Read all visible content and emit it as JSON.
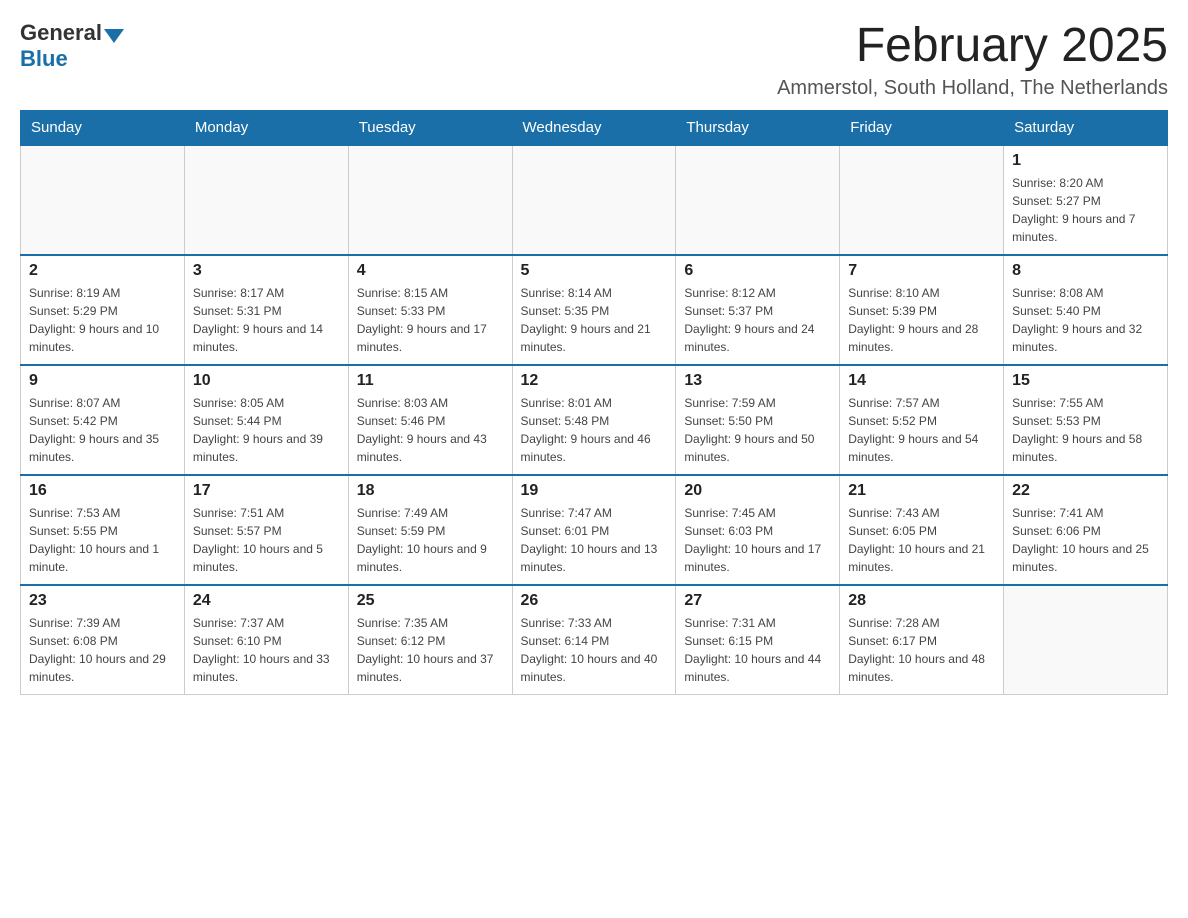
{
  "logo": {
    "general": "General",
    "blue": "Blue"
  },
  "title": {
    "month_year": "February 2025",
    "location": "Ammerstol, South Holland, The Netherlands"
  },
  "headers": [
    "Sunday",
    "Monday",
    "Tuesday",
    "Wednesday",
    "Thursday",
    "Friday",
    "Saturday"
  ],
  "weeks": [
    [
      {
        "day": "",
        "info": ""
      },
      {
        "day": "",
        "info": ""
      },
      {
        "day": "",
        "info": ""
      },
      {
        "day": "",
        "info": ""
      },
      {
        "day": "",
        "info": ""
      },
      {
        "day": "",
        "info": ""
      },
      {
        "day": "1",
        "info": "Sunrise: 8:20 AM\nSunset: 5:27 PM\nDaylight: 9 hours and 7 minutes."
      }
    ],
    [
      {
        "day": "2",
        "info": "Sunrise: 8:19 AM\nSunset: 5:29 PM\nDaylight: 9 hours and 10 minutes."
      },
      {
        "day": "3",
        "info": "Sunrise: 8:17 AM\nSunset: 5:31 PM\nDaylight: 9 hours and 14 minutes."
      },
      {
        "day": "4",
        "info": "Sunrise: 8:15 AM\nSunset: 5:33 PM\nDaylight: 9 hours and 17 minutes."
      },
      {
        "day": "5",
        "info": "Sunrise: 8:14 AM\nSunset: 5:35 PM\nDaylight: 9 hours and 21 minutes."
      },
      {
        "day": "6",
        "info": "Sunrise: 8:12 AM\nSunset: 5:37 PM\nDaylight: 9 hours and 24 minutes."
      },
      {
        "day": "7",
        "info": "Sunrise: 8:10 AM\nSunset: 5:39 PM\nDaylight: 9 hours and 28 minutes."
      },
      {
        "day": "8",
        "info": "Sunrise: 8:08 AM\nSunset: 5:40 PM\nDaylight: 9 hours and 32 minutes."
      }
    ],
    [
      {
        "day": "9",
        "info": "Sunrise: 8:07 AM\nSunset: 5:42 PM\nDaylight: 9 hours and 35 minutes."
      },
      {
        "day": "10",
        "info": "Sunrise: 8:05 AM\nSunset: 5:44 PM\nDaylight: 9 hours and 39 minutes."
      },
      {
        "day": "11",
        "info": "Sunrise: 8:03 AM\nSunset: 5:46 PM\nDaylight: 9 hours and 43 minutes."
      },
      {
        "day": "12",
        "info": "Sunrise: 8:01 AM\nSunset: 5:48 PM\nDaylight: 9 hours and 46 minutes."
      },
      {
        "day": "13",
        "info": "Sunrise: 7:59 AM\nSunset: 5:50 PM\nDaylight: 9 hours and 50 minutes."
      },
      {
        "day": "14",
        "info": "Sunrise: 7:57 AM\nSunset: 5:52 PM\nDaylight: 9 hours and 54 minutes."
      },
      {
        "day": "15",
        "info": "Sunrise: 7:55 AM\nSunset: 5:53 PM\nDaylight: 9 hours and 58 minutes."
      }
    ],
    [
      {
        "day": "16",
        "info": "Sunrise: 7:53 AM\nSunset: 5:55 PM\nDaylight: 10 hours and 1 minute."
      },
      {
        "day": "17",
        "info": "Sunrise: 7:51 AM\nSunset: 5:57 PM\nDaylight: 10 hours and 5 minutes."
      },
      {
        "day": "18",
        "info": "Sunrise: 7:49 AM\nSunset: 5:59 PM\nDaylight: 10 hours and 9 minutes."
      },
      {
        "day": "19",
        "info": "Sunrise: 7:47 AM\nSunset: 6:01 PM\nDaylight: 10 hours and 13 minutes."
      },
      {
        "day": "20",
        "info": "Sunrise: 7:45 AM\nSunset: 6:03 PM\nDaylight: 10 hours and 17 minutes."
      },
      {
        "day": "21",
        "info": "Sunrise: 7:43 AM\nSunset: 6:05 PM\nDaylight: 10 hours and 21 minutes."
      },
      {
        "day": "22",
        "info": "Sunrise: 7:41 AM\nSunset: 6:06 PM\nDaylight: 10 hours and 25 minutes."
      }
    ],
    [
      {
        "day": "23",
        "info": "Sunrise: 7:39 AM\nSunset: 6:08 PM\nDaylight: 10 hours and 29 minutes."
      },
      {
        "day": "24",
        "info": "Sunrise: 7:37 AM\nSunset: 6:10 PM\nDaylight: 10 hours and 33 minutes."
      },
      {
        "day": "25",
        "info": "Sunrise: 7:35 AM\nSunset: 6:12 PM\nDaylight: 10 hours and 37 minutes."
      },
      {
        "day": "26",
        "info": "Sunrise: 7:33 AM\nSunset: 6:14 PM\nDaylight: 10 hours and 40 minutes."
      },
      {
        "day": "27",
        "info": "Sunrise: 7:31 AM\nSunset: 6:15 PM\nDaylight: 10 hours and 44 minutes."
      },
      {
        "day": "28",
        "info": "Sunrise: 7:28 AM\nSunset: 6:17 PM\nDaylight: 10 hours and 48 minutes."
      },
      {
        "day": "",
        "info": ""
      }
    ]
  ]
}
